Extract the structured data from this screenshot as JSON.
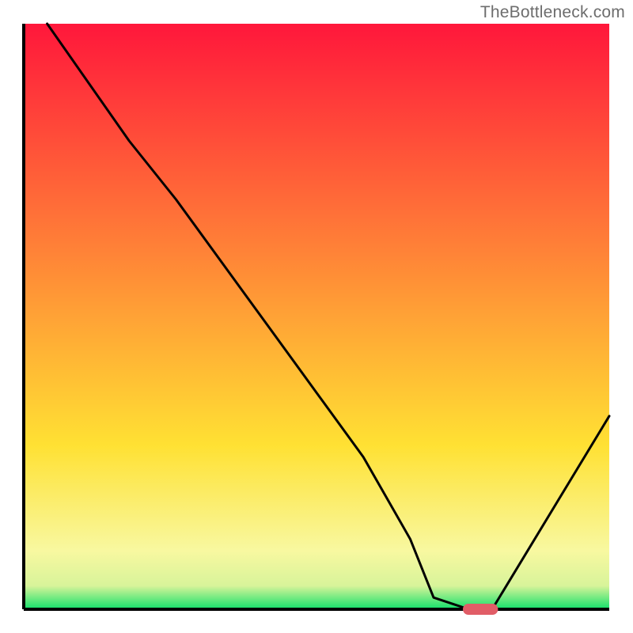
{
  "watermark": "TheBottleneck.com",
  "chart_data": {
    "type": "line",
    "title": "",
    "xlabel": "",
    "ylabel": "",
    "xlim": [
      0,
      100
    ],
    "ylim": [
      0,
      100
    ],
    "grid": false,
    "legend": false,
    "background_gradient": {
      "top_color": "#ff173b",
      "mid_upper_color": "#ff8037",
      "mid_lower_color": "#ffe133",
      "near_bottom_color": "#f8f8a0",
      "bottom_band_color": "#11e06a"
    },
    "x": [
      4,
      18,
      26,
      34,
      42,
      50,
      58,
      66,
      70,
      76,
      80,
      100
    ],
    "values": [
      100,
      80,
      70,
      59,
      48,
      37,
      26,
      12,
      2,
      0,
      0,
      33
    ],
    "marker": {
      "x_start": 75,
      "x_end": 81,
      "y": 0,
      "color": "#e15d67",
      "shape": "pill"
    }
  }
}
